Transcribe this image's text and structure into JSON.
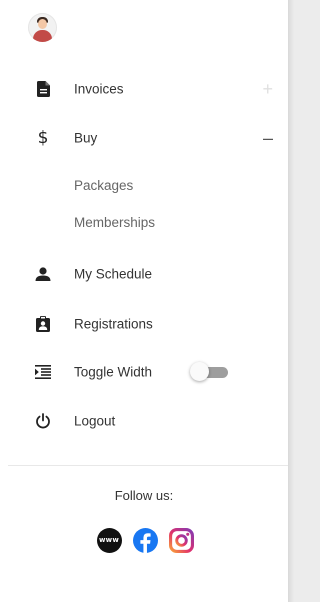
{
  "nav": {
    "invoices": {
      "label": "Invoices",
      "toggle": "+"
    },
    "buy": {
      "label": "Buy",
      "toggle": "–",
      "icon": "$"
    },
    "packages": {
      "label": "Packages"
    },
    "memberships": {
      "label": "Memberships"
    },
    "my_schedule": {
      "label": "My Schedule"
    },
    "registrations": {
      "label": "Registrations"
    },
    "toggle_width": {
      "label": "Toggle Width",
      "switch_on": false
    },
    "logout": {
      "label": "Logout"
    }
  },
  "footer": {
    "follow_label": "Follow us:",
    "www_label": "www",
    "social_icons": [
      "website-icon",
      "facebook-icon",
      "instagram-icon"
    ]
  },
  "icons": {
    "invoices": "document-icon",
    "buy": "dollar-icon",
    "my_schedule": "person-icon",
    "registrations": "clipboard-person-icon",
    "toggle_width": "indent-icon",
    "logout": "power-icon"
  },
  "colors": {
    "text": "#333333",
    "subtext": "#666666",
    "facebook": "#1877f2",
    "instagram": "#c13584"
  }
}
